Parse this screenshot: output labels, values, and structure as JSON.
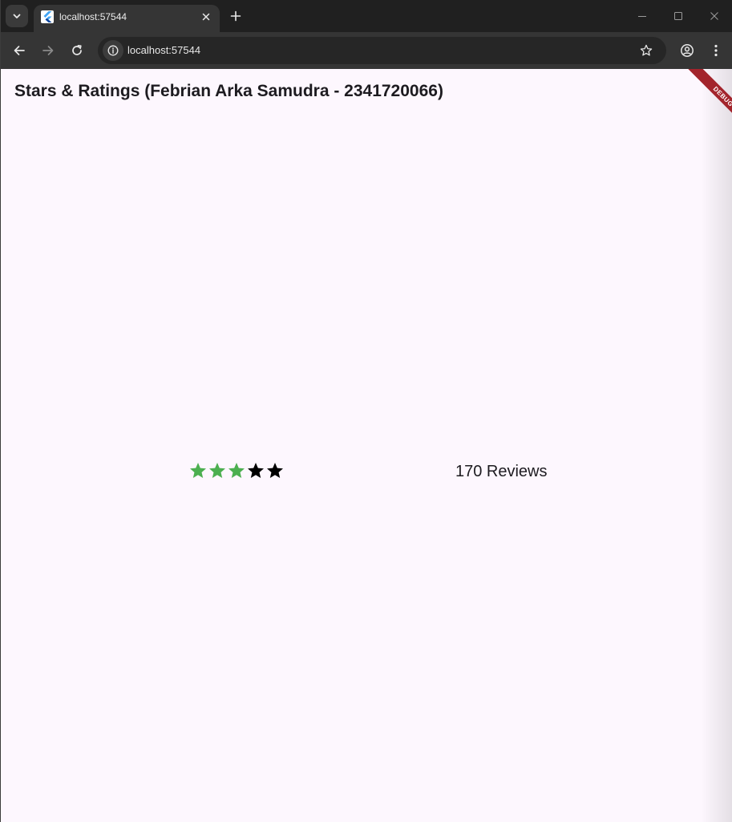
{
  "browser": {
    "tab_title": "localhost:57544",
    "url": "localhost:57544",
    "icons": {
      "tab_search": "chevron-down-icon",
      "favicon": "flutter-icon",
      "tab_close": "close-icon",
      "new_tab": "plus-icon",
      "minimize": "minimize-icon",
      "maximize": "maximize-icon",
      "window_close": "close-icon",
      "back": "arrow-left-icon",
      "forward": "arrow-right-icon",
      "reload": "reload-icon",
      "site_info": "info-icon",
      "bookmark": "star-outline-icon",
      "profile": "profile-icon",
      "menu": "kebab-menu-icon"
    }
  },
  "app": {
    "title": "Stars & Ratings (Febrian Arka Samudra - 2341720066)",
    "debug_banner": "DEBUG",
    "rating": {
      "value": 3,
      "max": 5,
      "filled_color": "#4caf50",
      "empty_color": "#000000"
    },
    "reviews_text": "170 Reviews"
  },
  "colors": {
    "page_background": "#fdf7fe",
    "debug_banner": "#a3242c",
    "browser_frame": "#202020",
    "toolbar": "#353535"
  }
}
